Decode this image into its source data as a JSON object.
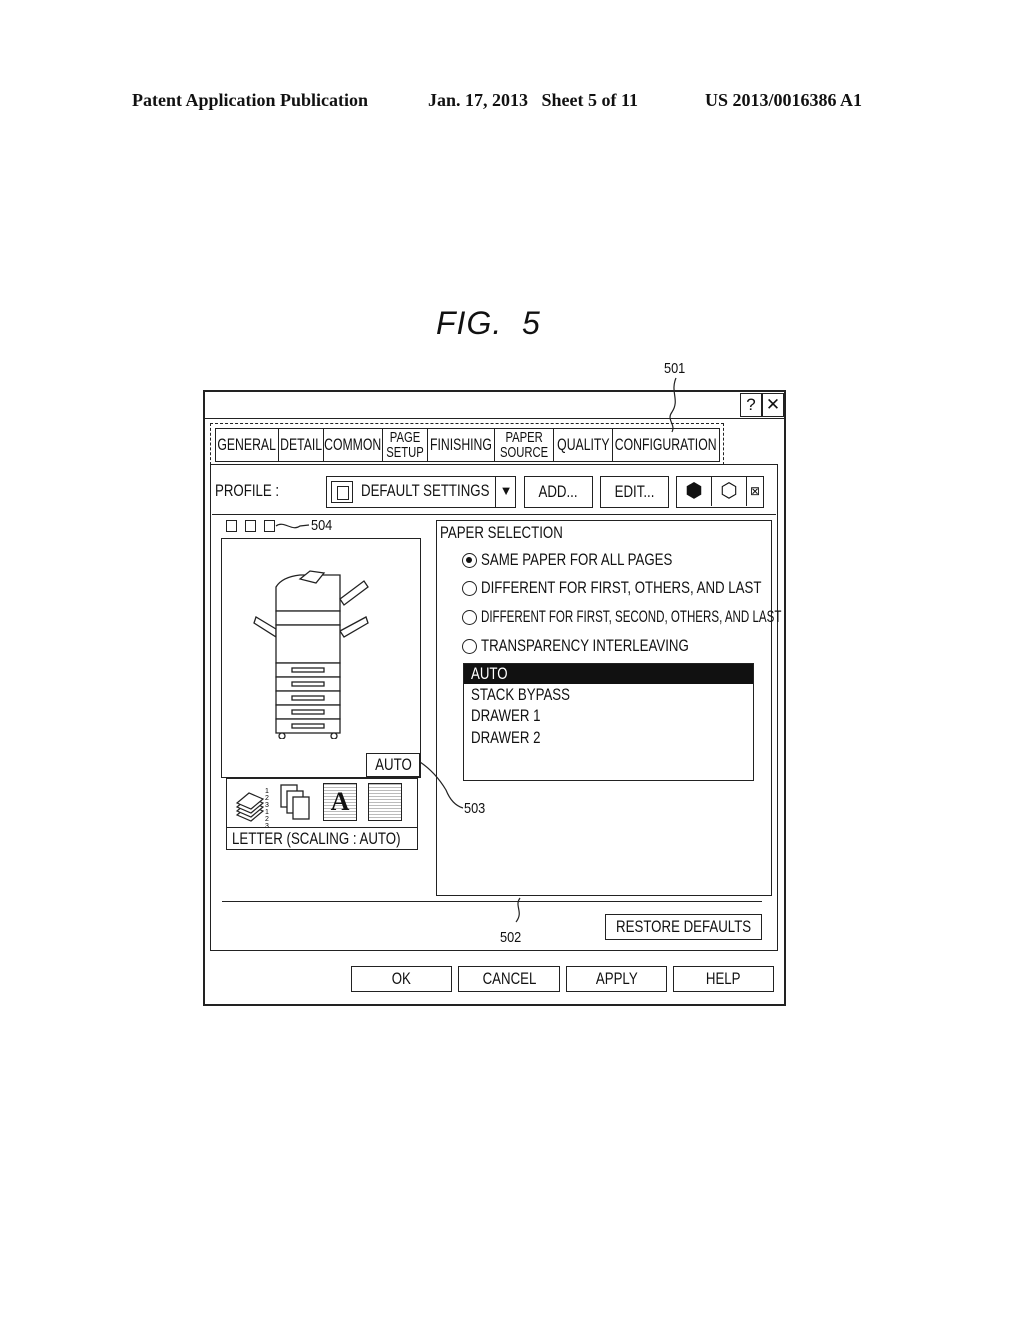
{
  "header": {
    "publication": "Patent Application Publication",
    "date_sheet": "Jan. 17, 2013   Sheet 5 of 11",
    "number": "US 2013/0016386 A1"
  },
  "figure_label": "FIG.  5",
  "reference_numerals": {
    "tabs": "501",
    "paper_source_panel": "502",
    "output_size_indicator": "503",
    "preview_view_buttons": "504"
  },
  "window": {
    "help_button": "?",
    "close_button": "✕",
    "tabs": [
      {
        "label": "GENERAL",
        "active": false
      },
      {
        "label": "DETAIL",
        "active": false
      },
      {
        "label": "COMMON",
        "active": false
      },
      {
        "label": "PAGE\nSETUP",
        "active": false
      },
      {
        "label": "FINISHING",
        "active": false
      },
      {
        "label": "PAPER\nSOURCE",
        "active": true
      },
      {
        "label": "QUALITY",
        "active": false
      },
      {
        "label": "CONFIGURATION",
        "active": false
      }
    ],
    "profile": {
      "label": "PROFILE :",
      "selected": "DEFAULT SETTINGS",
      "add_button": "ADD...",
      "edit_button": "EDIT...",
      "icons": [
        "printer-box-icon",
        "printer-open-icon",
        "delete-icon"
      ]
    },
    "preview": {
      "paper_source_badge": "AUTO",
      "status_text": "LETTER (SCALING : AUTO)",
      "icons": [
        "collate-icon",
        "stacked-pages-icon",
        "text-quality-icon",
        "halftone-icon"
      ],
      "collate_digits": "1\n2\n3\n1\n2\n3"
    },
    "paper_selection": {
      "title": "PAPER SELECTION",
      "options": [
        {
          "label": "SAME PAPER FOR ALL PAGES",
          "checked": true
        },
        {
          "label": "DIFFERENT FOR FIRST, OTHERS, AND LAST",
          "checked": false
        },
        {
          "label": "DIFFERENT FOR FIRST, SECOND, OTHERS, AND LAST",
          "checked": false
        },
        {
          "label": "TRANSPARENCY INTERLEAVING",
          "checked": false
        }
      ],
      "sources": [
        {
          "label": "AUTO",
          "selected": true
        },
        {
          "label": "STACK BYPASS",
          "selected": false
        },
        {
          "label": "DRAWER 1",
          "selected": false
        },
        {
          "label": "DRAWER 2",
          "selected": false
        }
      ]
    },
    "restore_defaults_button": "RESTORE DEFAULTS",
    "footer_buttons": {
      "ok": "OK",
      "cancel": "CANCEL",
      "apply": "APPLY",
      "help": "HELP"
    }
  }
}
